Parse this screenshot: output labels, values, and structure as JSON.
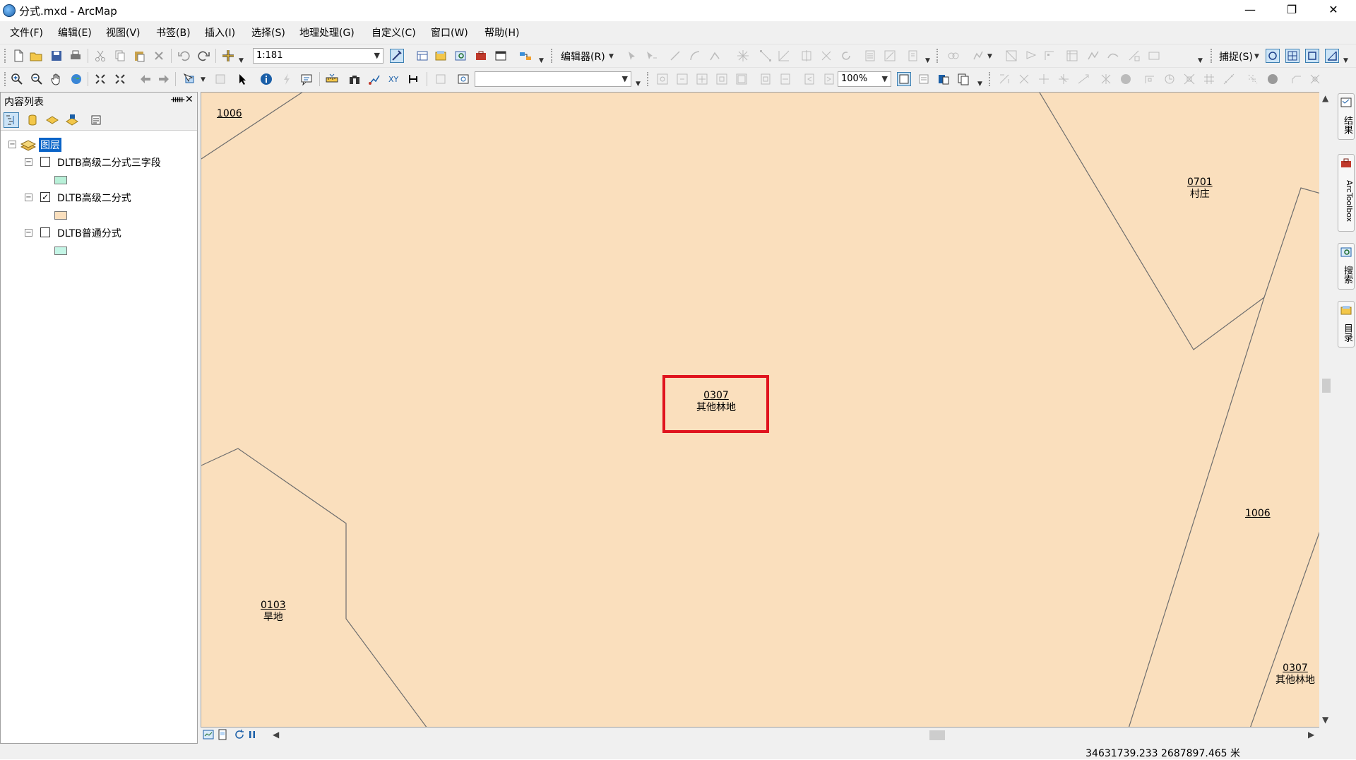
{
  "window": {
    "title": "分式.mxd - ArcMap",
    "minimize_glyph": "—",
    "restore_glyph": "❐",
    "close_glyph": "✕"
  },
  "menu": [
    {
      "id": "file",
      "label": "文件(F)"
    },
    {
      "id": "edit",
      "label": "编辑(E)"
    },
    {
      "id": "view",
      "label": "视图(V)"
    },
    {
      "id": "bookmarks",
      "label": "书签(B)"
    },
    {
      "id": "insert",
      "label": "插入(I)"
    },
    {
      "id": "selection",
      "label": "选择(S)"
    },
    {
      "id": "geoprocessing",
      "label": "地理处理(G)"
    },
    {
      "id": "customize",
      "label": "自定义(C)"
    },
    {
      "id": "windows",
      "label": "窗口(W)"
    },
    {
      "id": "help",
      "label": "帮助(H)"
    }
  ],
  "toolbar": {
    "scale_value": "1:181",
    "editor_label": "编辑器(R)",
    "snapping_label": "捕捉(S)",
    "zoom_value": "100%",
    "search_value": ""
  },
  "toc": {
    "title": "内容列表",
    "pin_glyph": "ᚔ",
    "close_glyph": "✕",
    "root_label": "图层",
    "layers": [
      {
        "name": "DLTB高级二分式三字段",
        "checked": false,
        "swatch_color": "#b8f0d8"
      },
      {
        "name": "DLTB高级二分式",
        "checked": true,
        "swatch_color": "#fadfbd"
      },
      {
        "name": "DLTB普通分式",
        "checked": false,
        "swatch_color": "#c4f5e6"
      }
    ],
    "check_mark": "✓"
  },
  "map": {
    "background": "#fadfbd",
    "highlight_color": "#e0141e",
    "labels": [
      {
        "id": "label-1006-topleft",
        "code": "1006",
        "name": ""
      },
      {
        "id": "label-0701",
        "code": "0701",
        "name": "村庄"
      },
      {
        "id": "label-0307-center",
        "code": "0307",
        "name": "其他林地"
      },
      {
        "id": "label-1006-right",
        "code": "1006",
        "name": ""
      },
      {
        "id": "label-0103",
        "code": "0103",
        "name": "旱地"
      },
      {
        "id": "label-0307-bottomright",
        "code": "0307",
        "name": "其他林地"
      }
    ]
  },
  "dock": {
    "tabs": [
      {
        "id": "results",
        "label": "结果"
      },
      {
        "id": "arctoolbox",
        "label": "ArcToolbox"
      },
      {
        "id": "search",
        "label": "搜索"
      },
      {
        "id": "catalog",
        "label": "目录"
      }
    ]
  },
  "status": {
    "coordinates": "34631739.233  2687897.465 米"
  }
}
